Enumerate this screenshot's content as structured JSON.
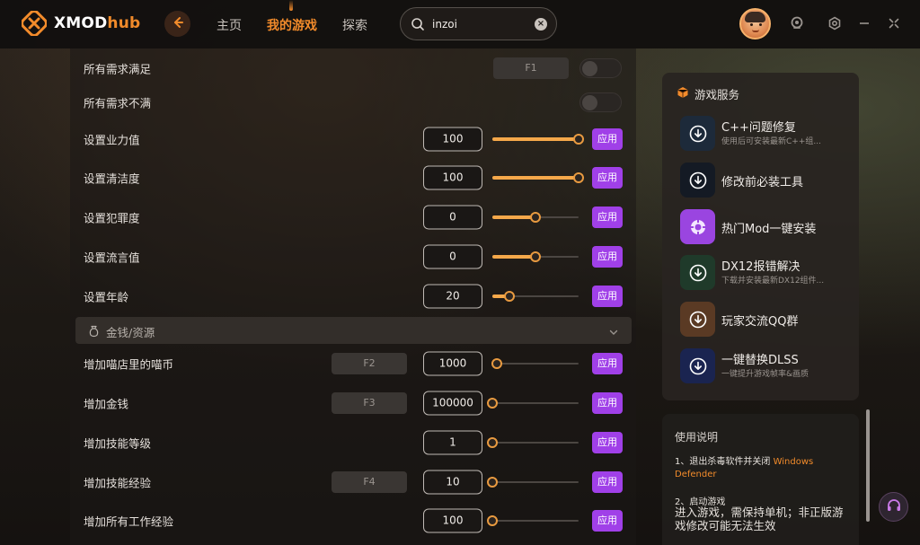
{
  "app": {
    "logo_main": "XMOD",
    "logo_accent": "hub",
    "accent_color": "#f28b2b",
    "apply_color": "#a040e8"
  },
  "nav": {
    "items": [
      {
        "label": "主页",
        "active": false
      },
      {
        "label": "我的游戏",
        "active": true
      },
      {
        "label": "探索",
        "active": false
      }
    ]
  },
  "search": {
    "value": "inzoi",
    "icon": "search-icon"
  },
  "toggle_rows": [
    {
      "label": "所有需求满足",
      "hotkey": "F1",
      "on": false
    },
    {
      "label": "所有需求不满",
      "hotkey": "",
      "on": false
    }
  ],
  "apply_label": "应用",
  "slider_rows": [
    {
      "label": "设置业力值",
      "value": "100",
      "level": 1.0
    },
    {
      "label": "设置清洁度",
      "value": "100",
      "level": 1.0
    },
    {
      "label": "设置犯罪度",
      "value": "0",
      "level": 0.5
    },
    {
      "label": "设置流言值",
      "value": "0",
      "level": 0.5
    },
    {
      "label": "设置年龄",
      "value": "20",
      "level": 0.2
    }
  ],
  "section": {
    "title": "金钱/资源"
  },
  "resource_rows": [
    {
      "label": "增加喵店里的喵币",
      "hotkey": "F2",
      "value": "1000",
      "level": 0.05
    },
    {
      "label": "增加金钱",
      "hotkey": "F3",
      "value": "100000",
      "level": 0.0
    },
    {
      "label": "增加技能等级",
      "hotkey": "",
      "value": "1",
      "level": 0.0
    },
    {
      "label": "增加技能经验",
      "hotkey": "F4",
      "value": "10",
      "level": 0.0
    },
    {
      "label": "增加所有工作经验",
      "hotkey": "",
      "value": "100",
      "level": 0.0
    }
  ],
  "services": {
    "title": "游戏服务",
    "items": [
      {
        "name": "C++问题修复",
        "sub": "使用后可安装最新C++组...",
        "icon": "download-icon"
      },
      {
        "name": "修改前必装工具",
        "sub": "",
        "icon": "download-icon"
      },
      {
        "name": "热门Mod一键安装",
        "sub": "",
        "icon": "mod-icon"
      },
      {
        "name": "DX12报错解决",
        "sub": "下载并安装最新DX12组件...",
        "icon": "download-icon"
      },
      {
        "name": "玩家交流QQ群",
        "sub": "",
        "icon": "download-icon"
      },
      {
        "name": "一键替换DLSS",
        "sub": "一键提升游戏帧率&画质",
        "icon": "download-icon"
      }
    ]
  },
  "help": {
    "title": "使用说明",
    "step1_prefix": "1、退出杀毒软件并关闭",
    "step1_highlight": "Windows Defender",
    "step2_title": "2、启动游戏",
    "step2_body": "进入游戏，需保持单机；非正版游戏修改可能无法生效"
  }
}
